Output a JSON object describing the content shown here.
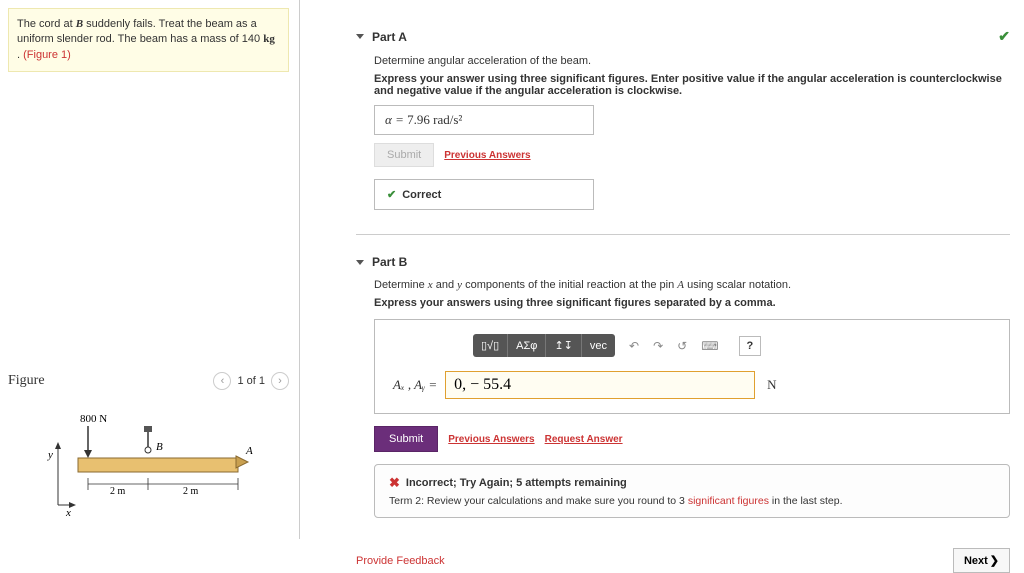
{
  "problem": {
    "text_pre": "The cord at ",
    "point": "B",
    "text_mid": " suddenly fails. Treat the beam as a uniform slender rod. The beam has a mass of 140 ",
    "unit": "kg",
    "text_post": " . ",
    "fig_ref": "(Figure 1)"
  },
  "figure": {
    "label": "Figure",
    "pager_text": "1 of 1",
    "force_label": "800 N",
    "point_a": "A",
    "point_b": "B",
    "dim": "2 m",
    "axis_x": "x",
    "axis_y": "y"
  },
  "partA": {
    "title": "Part A",
    "prompt": "Determine angular acceleration of the beam.",
    "hint": "Express your answer using three significant figures. Enter positive value if the angular acceleration is counterclockwise and negative value if the angular acceleration is clockwise.",
    "answer_prefix": "α =",
    "answer_value": "7.96",
    "answer_unit": "rad/s²",
    "submit": "Submit",
    "prev_answers": "Previous Answers",
    "correct": "Correct"
  },
  "partB": {
    "title": "Part B",
    "prompt_pre": "Determine ",
    "var_x": "x",
    "prompt_mid1": " and ",
    "var_y": "y",
    "prompt_mid2": " components of the initial reaction at the pin ",
    "pin": "A",
    "prompt_post": " using scalar notation.",
    "hint": "Express your answers using three significant figures separated by a comma.",
    "toolbar": {
      "templates": "▯√▯",
      "greek": "ΑΣφ",
      "arrows": "↥↧",
      "vec": "vec"
    },
    "help": "?",
    "eq_label": "Aₓ , Aᵧ =",
    "input_value": "0, − 55.4",
    "unit": "N",
    "submit": "Submit",
    "prev_answers": "Previous Answers",
    "request_answer": "Request Answer",
    "feedback_title": "Incorrect; Try Again; 5 attempts remaining",
    "feedback_body_pre": "Term 2: Review your calculations and make sure you round to 3 ",
    "feedback_sig": "significant figures",
    "feedback_body_post": " in the last step."
  },
  "footer": {
    "provide_feedback": "Provide Feedback",
    "next": "Next"
  }
}
